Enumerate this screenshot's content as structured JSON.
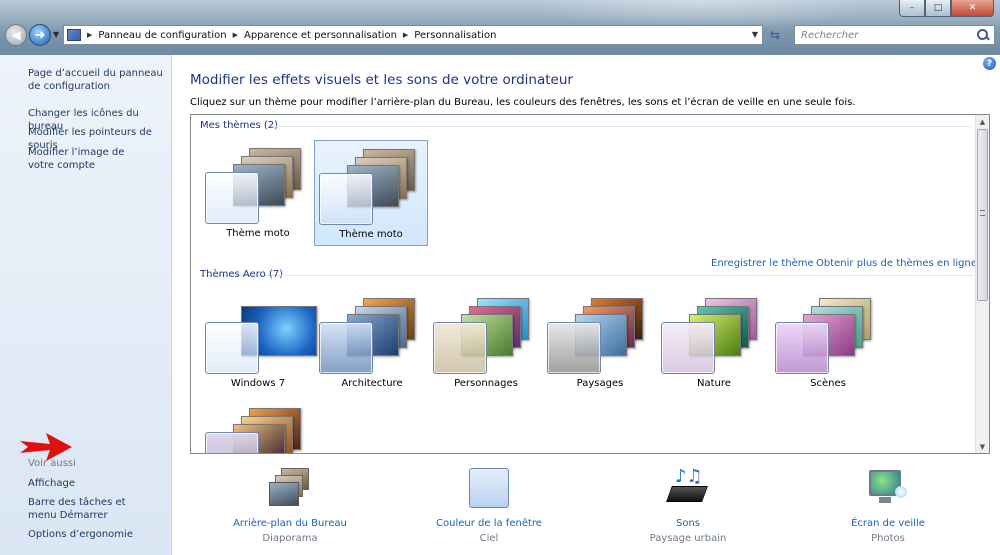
{
  "window": {
    "minimize": "–",
    "maximize": "□",
    "close": "✕"
  },
  "nav": {
    "back": "◀",
    "forward": "➜",
    "breadcrumbs": [
      "Panneau de configuration",
      "Apparence et personnalisation",
      "Personnalisation"
    ],
    "search_placeholder": "Rechercher"
  },
  "sidebar": {
    "links": [
      "Page d’accueil du panneau de configuration",
      "Changer les icônes du bureau",
      "Modifier les pointeurs de souris",
      "Modifier l’image de votre compte"
    ],
    "see_also_label": "Voir aussi",
    "see_also": [
      "Affichage",
      "Barre des tâches et menu Démarrer",
      "Options d’ergonomie"
    ]
  },
  "main": {
    "title": "Modifier les effets visuels et les sons de votre ordinateur",
    "description": "Cliquez sur un thème pour modifier l’arrière-plan du Bureau, les couleurs des fenêtres, les sons et l’écran de veille en une seule fois.",
    "my_themes": {
      "label": "Mes thèmes (2)",
      "items": [
        "Thème moto",
        "Thème moto"
      ],
      "selected_index": 1
    },
    "save_theme": "Enregistrer le thème",
    "more_themes": "Obtenir plus de thèmes en ligne",
    "aero_themes": {
      "label": "Thèmes Aero (7)",
      "items": [
        "Windows 7",
        "Architecture",
        "Personnages",
        "Paysages",
        "Nature",
        "Scènes",
        ""
      ]
    }
  },
  "bottom": [
    {
      "link": "Arrière-plan du Bureau",
      "sub": "Diaporama"
    },
    {
      "link": "Couleur de la fenêtre",
      "sub": "Ciel"
    },
    {
      "link": "Sons",
      "sub": "Paysage urbain"
    },
    {
      "link": "Écran de veille",
      "sub": "Photos"
    }
  ],
  "colors": {
    "link": "#1e5fb3",
    "heading": "#1e3287",
    "annotation_arrow": "#e01010"
  }
}
